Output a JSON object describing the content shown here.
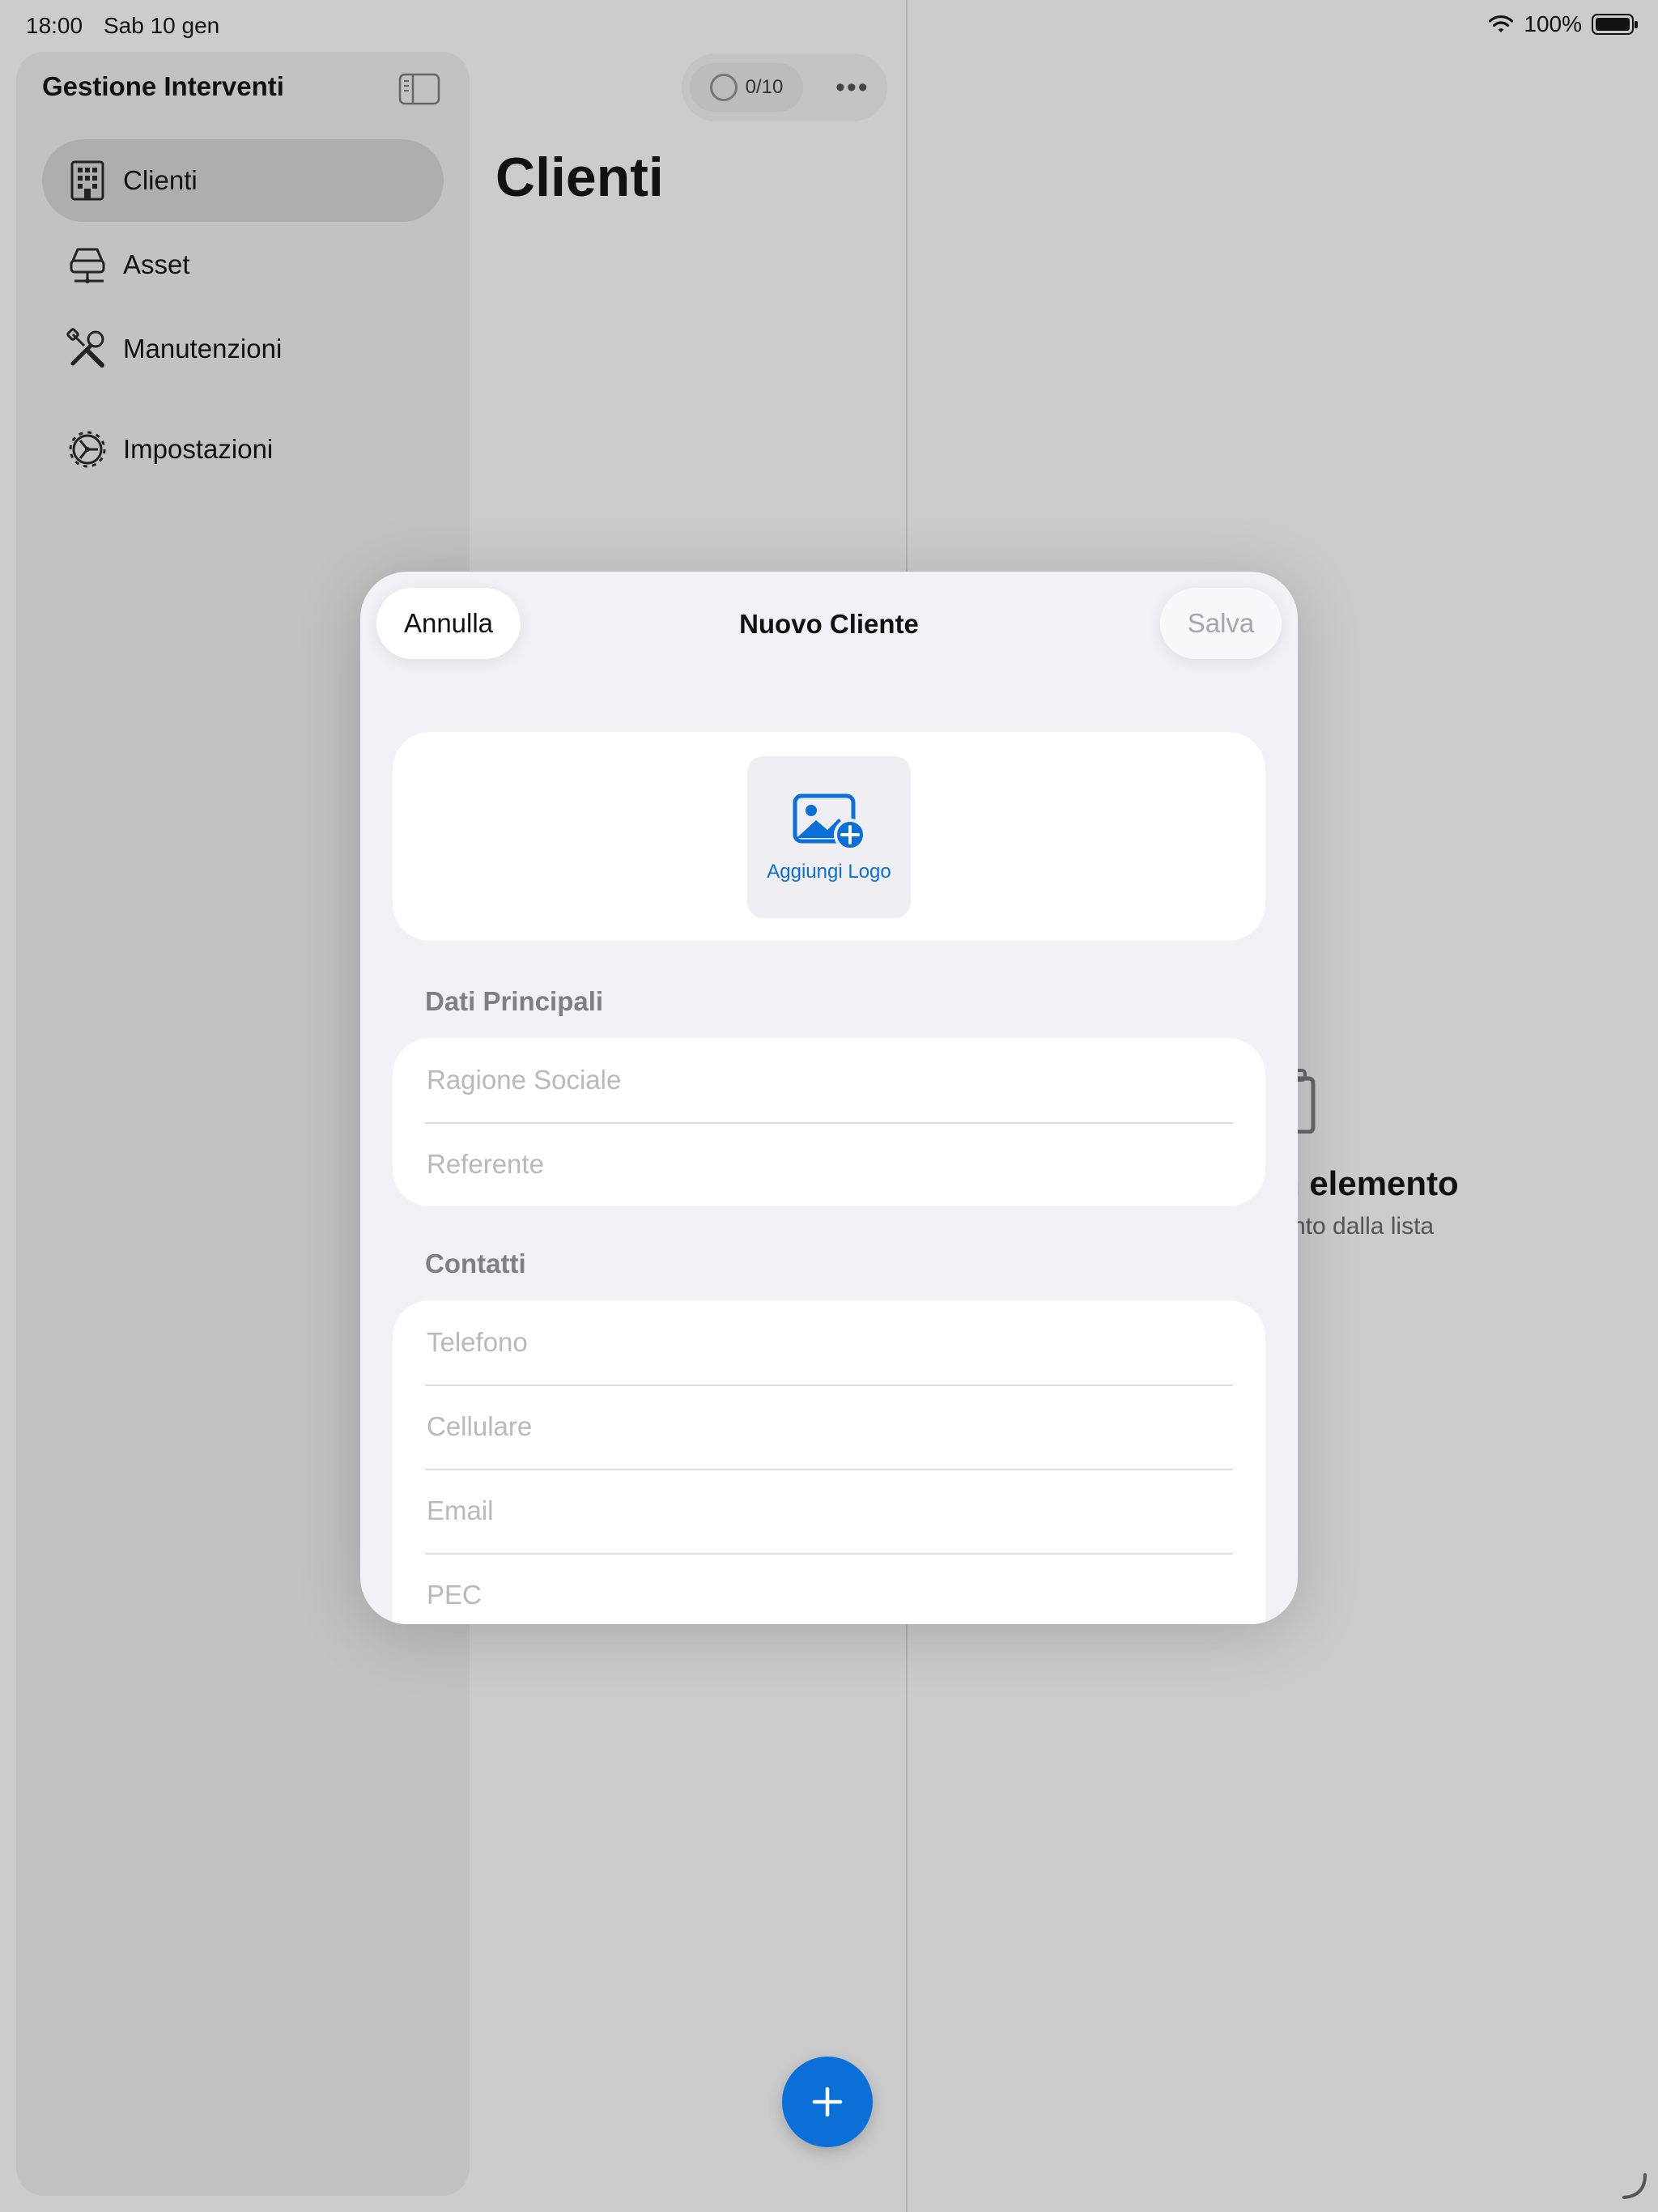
{
  "status_bar": {
    "time": "18:00",
    "date": "Sab 10 gen",
    "battery": "100%",
    "wifi_icon": "wifi-icon",
    "battery_icon": "battery-icon"
  },
  "sidebar": {
    "title": "Gestione Interventi",
    "toggle_icon": "sidebar-toggle-icon",
    "items": [
      {
        "label": "Clienti",
        "icon": "building-icon",
        "active": true
      },
      {
        "label": "Asset",
        "icon": "server-icon",
        "active": false
      },
      {
        "label": "Manutenzioni",
        "icon": "tools-icon",
        "active": false
      },
      {
        "label": "Impostazioni",
        "icon": "gear-icon",
        "active": false
      }
    ]
  },
  "list": {
    "title": "Clienti",
    "progress": "0/10",
    "more_icon": "ellipsis-icon",
    "add_icon": "plus-icon"
  },
  "detail": {
    "empty_title": "n elemento",
    "empty_subtitle": "nto dalla lista"
  },
  "sheet": {
    "title": "Nuovo Cliente",
    "cancel_label": "Annulla",
    "save_label": "Salva",
    "logo_label": "Aggiungi Logo",
    "logo_icon": "photo-badge-plus-icon",
    "sections": [
      {
        "header": "Dati Principali",
        "fields": [
          {
            "placeholder": "Ragione Sociale",
            "value": ""
          },
          {
            "placeholder": "Referente",
            "value": ""
          }
        ]
      },
      {
        "header": "Contatti",
        "fields": [
          {
            "placeholder": "Telefono",
            "value": ""
          },
          {
            "placeholder": "Cellulare",
            "value": ""
          },
          {
            "placeholder": "Email",
            "value": ""
          },
          {
            "placeholder": "PEC",
            "value": ""
          }
        ]
      }
    ]
  },
  "colors": {
    "accent": "#0a6fd6",
    "sheet_background": "#f2f2f6",
    "placeholder": "#b9b9bd",
    "section_header": "#7e7e84"
  }
}
